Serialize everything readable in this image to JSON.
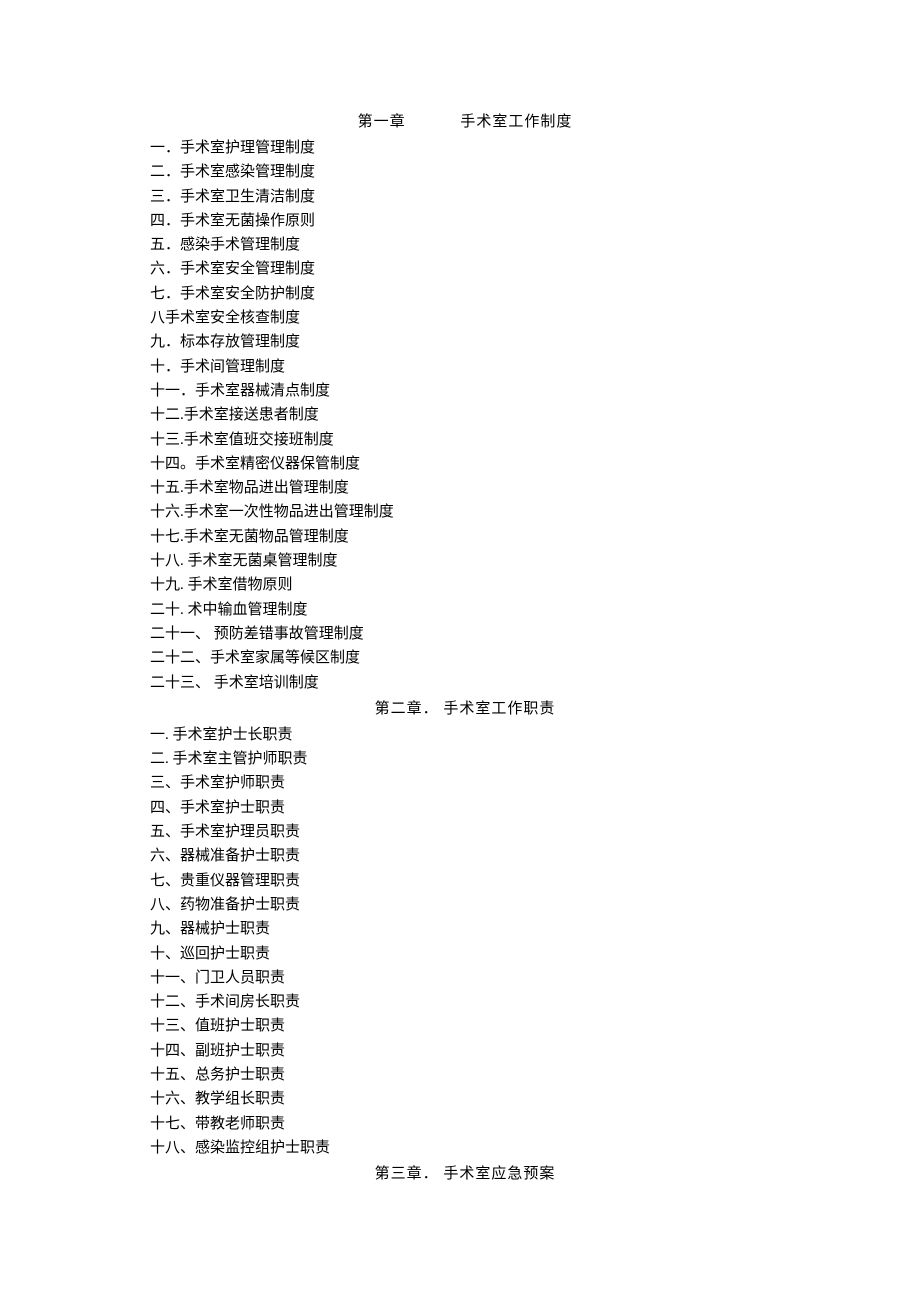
{
  "chapters": [
    {
      "heading_num": "第一章",
      "heading_title": "手术室工作制度",
      "items": [
        "一．手术室护理管理制度",
        "二．手术室感染管理制度",
        "三．手术室卫生清洁制度",
        "四．手术室无菌操作原则",
        "五．感染手术管理制度",
        "六．手术室安全管理制度",
        "七．手术室安全防护制度",
        "八手术室安全核查制度",
        "九．标本存放管理制度",
        "十．手术间管理制度",
        "十一．手术室器械清点制度",
        "十二.手术室接送患者制度",
        "十三.手术室值班交接班制度",
        "十四。手术室精密仪器保管制度",
        "十五.手术室物品进出管理制度",
        "十六.手术室一次性物品进出管理制度",
        "十七.手术室无菌物品管理制度",
        "十八. 手术室无菌桌管理制度",
        "十九. 手术室借物原则",
        "二十. 术中输血管理制度",
        "二十一、 预防差错事故管理制度",
        "二十二、手术室家属等候区制度",
        "二十三、 手术室培训制度"
      ]
    },
    {
      "heading_num": "第二章．",
      "heading_title": "手术室工作职责",
      "items": [
        "一. 手术室护士长职责",
        "二. 手术室主管护师职责",
        "三、手术室护师职责",
        "四、手术室护士职责",
        "五、手术室护理员职责",
        "六、器械准备护士职责",
        "七、贵重仪器管理职责",
        " 八、药物准备护士职责",
        " 九、器械护士职责",
        " 十、巡回护士职责",
        " 十一、门卫人员职责",
        " 十二、手术间房长职责",
        " 十三、值班护士职责",
        " 十四、副班护士职责",
        " 十五、总务护士职责",
        " 十六、教学组长职责",
        " 十七、带教老师职责",
        " 十八、感染监控组护士职责"
      ]
    },
    {
      "heading_num": "第三章．",
      "heading_title": "手术室应急预案",
      "items": []
    }
  ]
}
